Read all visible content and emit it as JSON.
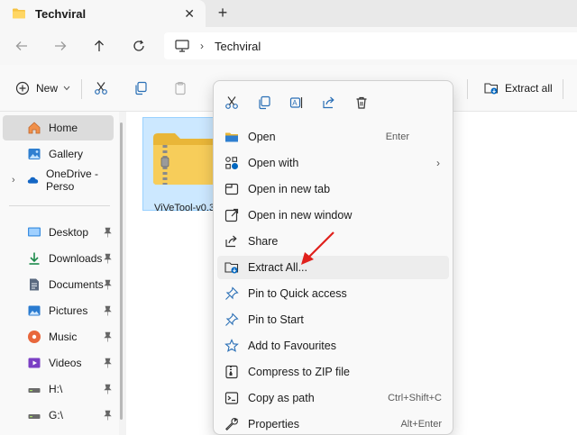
{
  "tab": {
    "title": "Techviral",
    "close": "✕",
    "new_tab": "+"
  },
  "address": {
    "crumb": "Techviral",
    "separator": "›"
  },
  "command_bar": {
    "new_label": "New",
    "extract_all_label": "Extract all"
  },
  "sidebar": {
    "items": [
      {
        "label": "Home"
      },
      {
        "label": "Gallery"
      },
      {
        "label": "OneDrive - Perso"
      },
      {
        "label": "Desktop"
      },
      {
        "label": "Downloads"
      },
      {
        "label": "Documents"
      },
      {
        "label": "Pictures"
      },
      {
        "label": "Music"
      },
      {
        "label": "Videos"
      },
      {
        "label": "H:\\"
      },
      {
        "label": "G:\\"
      }
    ]
  },
  "file": {
    "name": "ViVeTool-v0.3."
  },
  "context_menu": {
    "items": [
      {
        "label": "Open",
        "shortcut": "Enter"
      },
      {
        "label": "Open with",
        "arrow": "›"
      },
      {
        "label": "Open in new tab"
      },
      {
        "label": "Open in new window"
      },
      {
        "label": "Share"
      },
      {
        "label": "Extract All..."
      },
      {
        "label": "Pin to Quick access"
      },
      {
        "label": "Pin to Start"
      },
      {
        "label": "Add to Favourites"
      },
      {
        "label": "Compress to ZIP file"
      },
      {
        "label": "Copy as path",
        "shortcut": "Ctrl+Shift+C"
      },
      {
        "label": "Properties",
        "shortcut": "Alt+Enter"
      }
    ]
  },
  "colors": {
    "accent_blue": "#0067c0",
    "folder_yellow": "#f5c343",
    "annotation_red": "#e0201c"
  }
}
